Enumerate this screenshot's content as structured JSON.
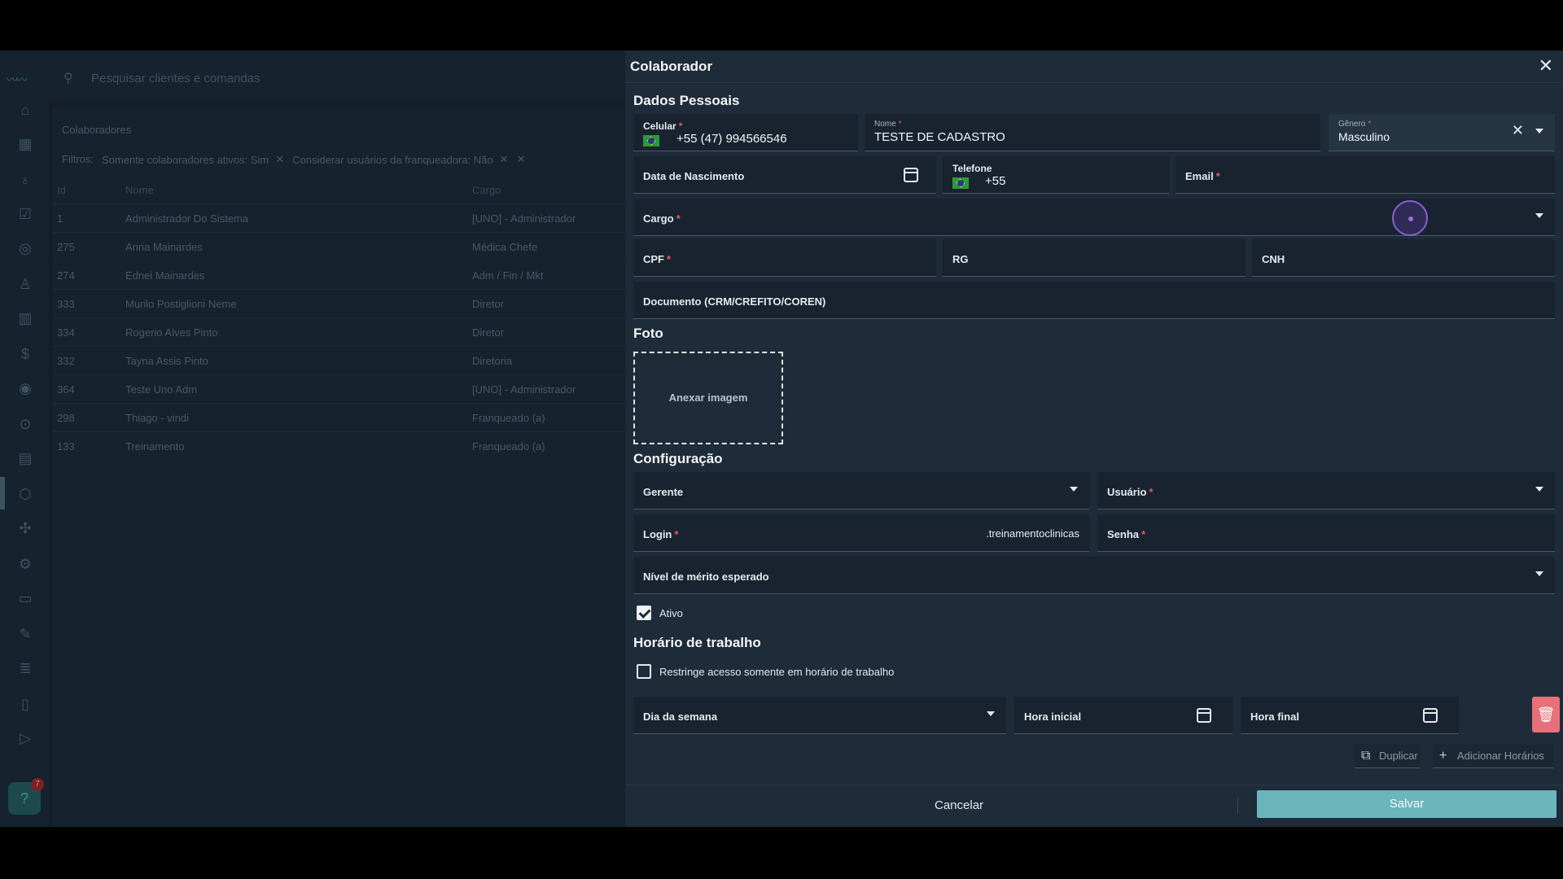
{
  "bg": {
    "search_placeholder": "Pesquisar clientes e comandas",
    "list_title": "Colaboradores",
    "filters_label": "Filtros:",
    "filters": [
      "Somente colaboradores ativos: Sim",
      "Considerar usuários da franqueadora: Não"
    ],
    "columns": {
      "id": "Id",
      "name": "Nome",
      "role": "Cargo"
    },
    "rows": [
      {
        "id": "1",
        "name": "Administrador Do Sistema",
        "role": "[UNO] - Administrador"
      },
      {
        "id": "275",
        "name": "Anna Mainardes",
        "role": "Médica Chefe"
      },
      {
        "id": "274",
        "name": "Ednei Mainardes",
        "role": "Adm / Fin / Mkt"
      },
      {
        "id": "333",
        "name": "Murilo Postiglioni Neme",
        "role": "Diretor"
      },
      {
        "id": "334",
        "name": "Rogerio Alves Pinto",
        "role": "Diretor"
      },
      {
        "id": "332",
        "name": "Tayna Assis Pinto",
        "role": "Diretoria"
      },
      {
        "id": "364",
        "name": "Teste Uno Adm",
        "role": "[UNO] - Administrador"
      },
      {
        "id": "298",
        "name": "Thiago - vindi",
        "role": "Franqueado (a)"
      },
      {
        "id": "133",
        "name": "Treinamento",
        "role": "Franqueado (a)"
      }
    ],
    "help_badge": "7"
  },
  "modal": {
    "title": "Colaborador",
    "sections": {
      "personal": "Dados Pessoais",
      "photo": "Foto",
      "config": "Configuração",
      "schedule": "Horário de trabalho"
    },
    "fields": {
      "celular_label": "Celular",
      "celular_value": "+55 (47) 994566546",
      "nome_label": "Nome",
      "nome_value": "TESTE DE CADASTRO",
      "genero_label": "Gênero",
      "genero_value": "Masculino",
      "nascimento_label": "Data de Nascimento",
      "telefone_label": "Telefone",
      "telefone_value": "+55",
      "email_label": "Email",
      "cargo_label": "Cargo",
      "cpf_label": "CPF",
      "rg_label": "RG",
      "cnh_label": "CNH",
      "documento_label": "Documento (CRM/CREFITO/COREN)",
      "upload_label": "Anexar imagem",
      "gerente_label": "Gerente",
      "usuario_label": "Usuário",
      "login_label": "Login",
      "login_suffix": ".treinamentoclinicas",
      "senha_label": "Senha",
      "merito_label": "Nível de mérito esperado",
      "ativo_label": "Ativo",
      "restringe_label": "Restringe acesso somente em horário de trabalho",
      "dia_label": "Dia da semana",
      "hora_inicial_label": "Hora inicial",
      "hora_final_label": "Hora final",
      "required_mark": "*"
    },
    "buttons": {
      "duplicar": "Duplicar",
      "adicionar": "Adicionar Horários",
      "cancelar": "Cancelar",
      "salvar": "Salvar"
    },
    "ativo_checked": true,
    "restringe_checked": false
  }
}
